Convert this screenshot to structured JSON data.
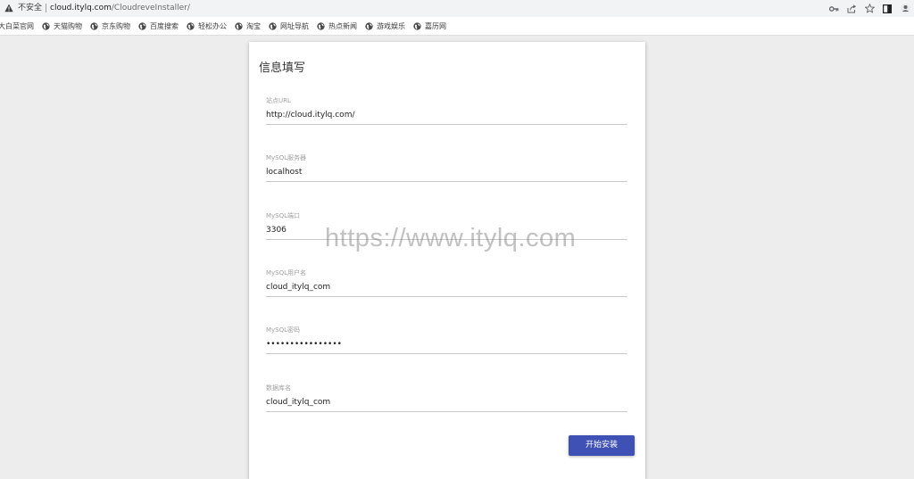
{
  "browser": {
    "security_label": "不安全",
    "url_host": "cloud.itylq.com",
    "url_path": "/CloudreveInstaller/",
    "bookmarks": [
      {
        "label": "大白菜官网"
      },
      {
        "label": "天猫购物"
      },
      {
        "label": "京东购物"
      },
      {
        "label": "百度搜索"
      },
      {
        "label": "轻松办公"
      },
      {
        "label": "淘宝"
      },
      {
        "label": "网址导航"
      },
      {
        "label": "热点新闻"
      },
      {
        "label": "游戏娱乐"
      },
      {
        "label": "嘉历网"
      }
    ],
    "toolbar_icons": [
      "key-icon",
      "share-icon",
      "star-icon",
      "side-panel-icon",
      "profile-icon"
    ]
  },
  "form": {
    "title": "信息填写",
    "fields": [
      {
        "label": "站点URL",
        "value": "http://cloud.itylq.com/",
        "type": "text"
      },
      {
        "label": "MySQL服务器",
        "value": "localhost",
        "type": "text"
      },
      {
        "label": "MySQL端口",
        "value": "3306",
        "type": "text"
      },
      {
        "label": "MySQL用户名",
        "value": "cloud_itylq_com",
        "type": "text"
      },
      {
        "label": "MySQL密码",
        "value": "••••••••••••••••",
        "type": "password"
      },
      {
        "label": "数据库名",
        "value": "cloud_itylq_com",
        "type": "text"
      }
    ],
    "submit_label": "开始安装"
  },
  "watermark": "https://www.itylq.com",
  "colors": {
    "primary_button": "#3f51b5",
    "page_background": "#ededed",
    "card_background": "#ffffff"
  }
}
